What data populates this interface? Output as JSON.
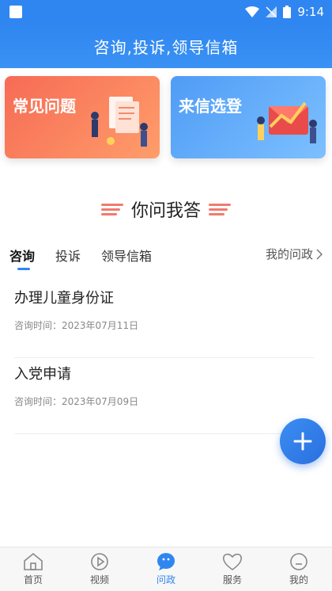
{
  "status": {
    "time": "9:14"
  },
  "header": {
    "title": "咨询,投诉,领导信箱"
  },
  "banners": [
    {
      "label": "常见问题"
    },
    {
      "label": "来信选登"
    }
  ],
  "section": {
    "title": "你问我答"
  },
  "tabs": {
    "items": [
      {
        "label": "咨询"
      },
      {
        "label": "投诉"
      },
      {
        "label": "领导信箱"
      }
    ],
    "more_label": "我的问政"
  },
  "list": [
    {
      "title": "办理儿童身份证",
      "date": "咨询时间：2023年07月11日"
    },
    {
      "title": "入党申请",
      "date": "咨询时间：2023年07月09日"
    }
  ],
  "bottom_nav": [
    {
      "label": "首页",
      "icon": "home-icon"
    },
    {
      "label": "视频",
      "icon": "play-icon"
    },
    {
      "label": "问政",
      "icon": "chat-icon"
    },
    {
      "label": "服务",
      "icon": "heart-icon"
    },
    {
      "label": "我的",
      "icon": "profile-icon"
    }
  ],
  "colors": {
    "accent": "#2f86f0",
    "banner_left": "#f66b55",
    "banner_right": "#4f9cf6"
  }
}
